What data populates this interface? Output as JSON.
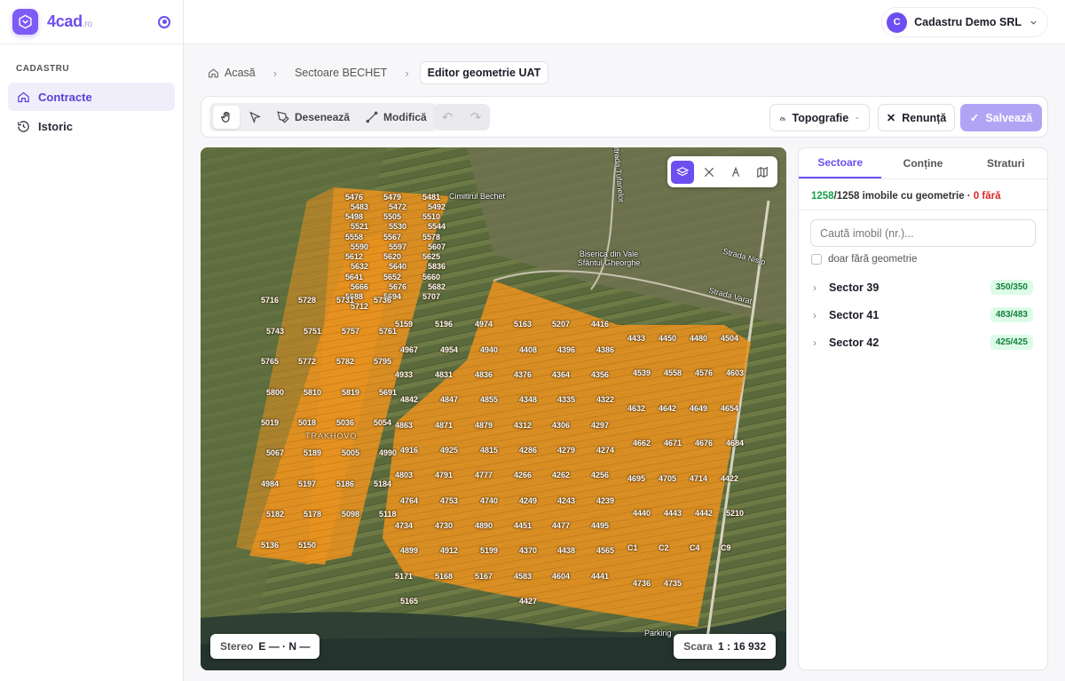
{
  "app": {
    "brand": "4cad",
    "brand_suffix": ".ro"
  },
  "sidebar": {
    "section": "CADASTRU",
    "items": [
      {
        "label": "Contracte",
        "icon": "home-icon",
        "active": true
      },
      {
        "label": "Istoric",
        "icon": "history-icon",
        "active": false
      }
    ]
  },
  "account": {
    "initial": "C",
    "name": "Cadastru Demo SRL"
  },
  "breadcrumb": {
    "home": "Acasă",
    "sector": "Sectoare BECHET",
    "current": "Editor geometrie UAT"
  },
  "toolbar": {
    "draw": "Desenează",
    "modify": "Modifică",
    "topography": "Topografie",
    "cancel": "Renunță",
    "save": "Salvează",
    "undo_icon": "undo-icon",
    "redo_icon": "redo-icon"
  },
  "map": {
    "labels": {
      "cemetery": "Cimitirul Bechet",
      "church": "Biserica din Vale\nSfântul Gheorghe",
      "street_nisip": "Strada Nisip",
      "street_varat": "Strada Varat",
      "street_tufanelor": "Strada Tufanelor",
      "parking": "Parking",
      "area": "TRAKHOVO"
    },
    "stereo_label": "Stereo",
    "stereo_value": "E — · N —",
    "scale_label": "Scara",
    "scale_value": "1 : 16 932",
    "lots": [
      "5476",
      "5479",
      "5481",
      "5483",
      "5472",
      "5492",
      "5498",
      "5505",
      "5510",
      "5521",
      "5530",
      "5544",
      "5558",
      "5567",
      "5578",
      "5590",
      "5597",
      "5607",
      "5612",
      "5620",
      "5625",
      "5632",
      "5640",
      "5836",
      "5641",
      "5652",
      "5660",
      "5666",
      "5676",
      "5682",
      "5688",
      "5694",
      "5707",
      "5712",
      "5716",
      "5728",
      "5731",
      "5736",
      "5743",
      "5751",
      "5757",
      "5761",
      "5765",
      "5772",
      "5782",
      "5795",
      "5800",
      "5810",
      "5819",
      "5691",
      "5019",
      "5018",
      "5036",
      "5054",
      "5067",
      "5189",
      "5005",
      "4990",
      "4984",
      "5197",
      "5186",
      "5184",
      "5182",
      "5178",
      "5098",
      "5118",
      "5136",
      "5150",
      "5159",
      "5196",
      "4974",
      "4967",
      "4954",
      "4940",
      "4933",
      "4831",
      "4836",
      "4842",
      "4847",
      "4855",
      "4863",
      "4871",
      "4879",
      "4916",
      "4925",
      "4815",
      "4803",
      "4791",
      "4777",
      "4764",
      "4753",
      "4740",
      "4734",
      "4730",
      "4890",
      "4899",
      "4912",
      "5199",
      "5171",
      "5168",
      "5167",
      "5165",
      "5163",
      "5207",
      "4416",
      "4408",
      "4396",
      "4386",
      "4376",
      "4364",
      "4356",
      "4348",
      "4335",
      "4322",
      "4312",
      "4306",
      "4297",
      "4286",
      "4279",
      "4274",
      "4266",
      "4262",
      "4256",
      "4249",
      "4243",
      "4239",
      "4451",
      "4477",
      "4495",
      "4370",
      "4438",
      "4565",
      "4583",
      "4604",
      "4441",
      "4427",
      "4433",
      "4450",
      "4480",
      "4504",
      "4539",
      "4558",
      "4576",
      "4603",
      "4632",
      "4642",
      "4649",
      "4654",
      "4662",
      "4671",
      "4676",
      "4684",
      "4695",
      "4705",
      "4714",
      "4422",
      "4440",
      "4443",
      "4442",
      "5210",
      "C1",
      "C2",
      "C4",
      "C9",
      "4736",
      "4735"
    ]
  },
  "panel": {
    "tabs": [
      "Sectoare",
      "Conține",
      "Straturi"
    ],
    "count_ok": "1258",
    "count_total": "/1258 imobile cu geometrie ·",
    "count_missing": "0 fără",
    "search_placeholder": "Caută imobil (nr.)...",
    "checkbox_label": "doar fără geometrie",
    "sectors": [
      {
        "name": "Sector 39",
        "badge": "350/350"
      },
      {
        "name": "Sector 41",
        "badge": "483/483"
      },
      {
        "name": "Sector 42",
        "badge": "425/425"
      }
    ]
  }
}
